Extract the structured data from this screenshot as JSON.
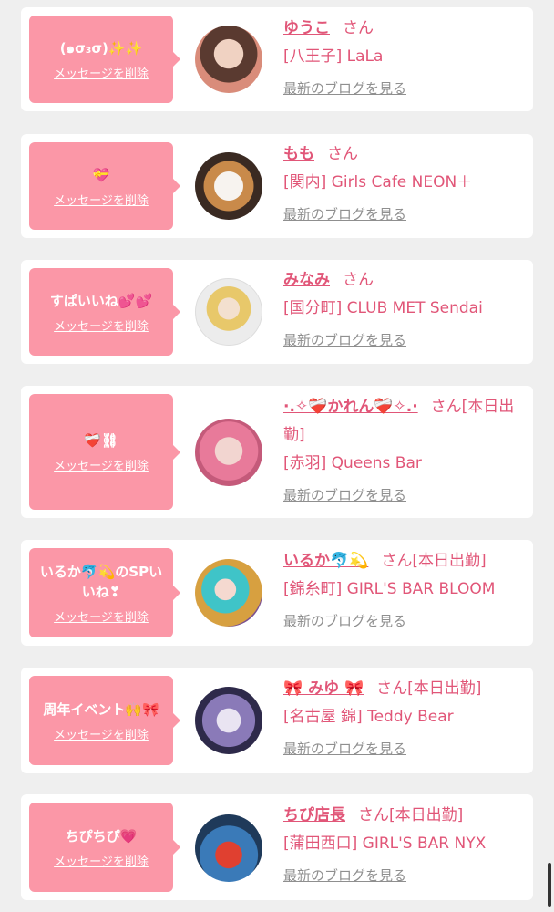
{
  "colors": {
    "page_bg": "#efefef",
    "card_bg": "#ffffff",
    "bubble_bg": "#fb97a7",
    "name": "#e15678",
    "blog_link": "#8f8f8f"
  },
  "entries": [
    {
      "message": "(๑σ₃σ)✨✨",
      "delete_label": "メッセージを削除",
      "name": "ゆうこ",
      "suffix": "さん",
      "shop": "[八王子] LaLa",
      "blog_link": "最新のブログを見る"
    },
    {
      "message": "💝",
      "delete_label": "メッセージを削除",
      "name": "もも",
      "suffix": "さん",
      "shop": "[関内] Girls Cafe NEON＋",
      "blog_link": "最新のブログを見る"
    },
    {
      "message": "すぱいいね💕💕",
      "delete_label": "メッセージを削除",
      "name": "みなみ",
      "suffix": "さん",
      "shop": "[国分町] CLUB MET Sendai",
      "blog_link": "最新のブログを見る"
    },
    {
      "message": "❤️‍🩹⛓",
      "delete_label": "メッセージを削除",
      "name": "·.✧❤️‍🩹かれん❤️‍🩹✧.·",
      "suffix": "さん[本日出勤]",
      "shop": "[赤羽] Queens Bar",
      "blog_link": "最新のブログを見る"
    },
    {
      "message": "いるか🐬💫のSPいいね❣",
      "delete_label": "メッセージを削除",
      "name": "いるか🐬💫",
      "suffix": "さん[本日出勤]",
      "shop": "[錦糸町] GIRL'S BAR BLOOM",
      "blog_link": "最新のブログを見る"
    },
    {
      "message": "周年イベント🙌🎀",
      "delete_label": "メッセージを削除",
      "name": "🎀 みゆ 🎀",
      "suffix": "さん[本日出勤]",
      "shop": "[名古屋 錦] Teddy Bear",
      "blog_link": "最新のブログを見る"
    },
    {
      "message": "ちぴちぴ💗",
      "delete_label": "メッセージを削除",
      "name": "ちぴ店長",
      "suffix": "さん[本日出勤]",
      "shop": "[蒲田西口] GIRL'S BAR NYX",
      "blog_link": "最新のブログを見る"
    }
  ]
}
